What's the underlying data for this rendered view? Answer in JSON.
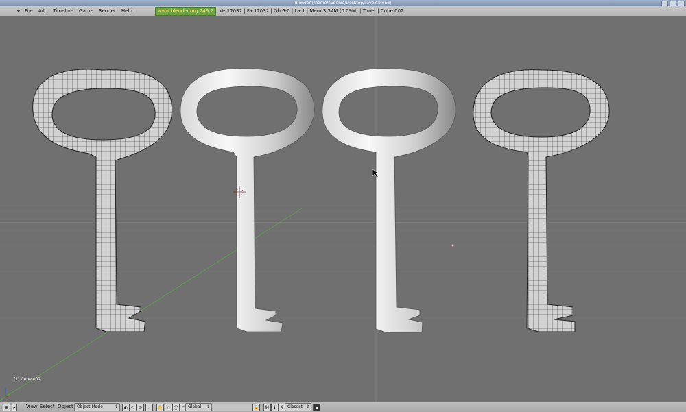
{
  "window": {
    "title": "Blender [/home/eugenio/Desktop/llave3.blend]"
  },
  "menu": {
    "items": [
      "File",
      "Add",
      "Timeline",
      "Game",
      "Render",
      "Help"
    ],
    "site": "www.blender.org 249.2",
    "stats": "Ve:12032 | Fa:12032 | Ob:6-0 | La:1  | Mem:3.54M (0.09M)  | Time: | Cube.002"
  },
  "viewport": {
    "object_label": "(1) Cube.002",
    "background_color": "#707070",
    "grid_color": "#7b7b7b"
  },
  "header": {
    "view": "View",
    "select": "Select",
    "object": "Object",
    "mode": "Object Mode",
    "orientation": "Global",
    "snap": "Closest"
  }
}
